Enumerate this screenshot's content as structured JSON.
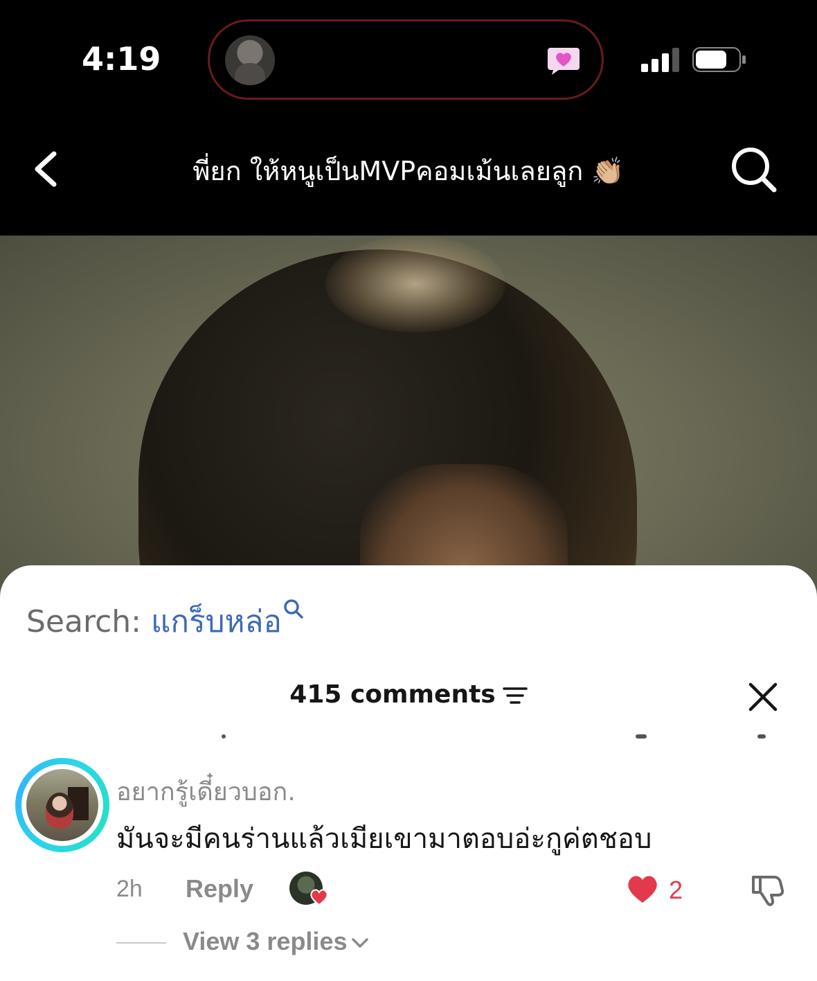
{
  "status_bar": {
    "time": "4:19"
  },
  "nav": {
    "title": "พี่ยก ให้หนูเป็นMVPคอมเม้นเลยลูก 👏🏼"
  },
  "sheet": {
    "search_prefix": "Search: ",
    "search_term": "แกร็บหล่อ",
    "comments_count": "415 comments"
  },
  "comment": {
    "username": "อยากรู้เดี๋ยวบอก.",
    "text": "มันจะมีคนร่านแล้วเมียเขามาตอบอ่ะกูค่ตชอบ",
    "time_ago": "2h",
    "reply_label": "Reply",
    "like_count": "2",
    "view_replies": "View 3 replies"
  },
  "colors": {
    "accent_blue": "#3d6ab5",
    "like_red": "#e23a4c",
    "island_border": "#6b1a1f"
  },
  "icons": [
    "back-icon",
    "search-icon",
    "heart-icon",
    "filter-icon",
    "close-icon",
    "dislike-icon",
    "chevron-down-icon"
  ]
}
